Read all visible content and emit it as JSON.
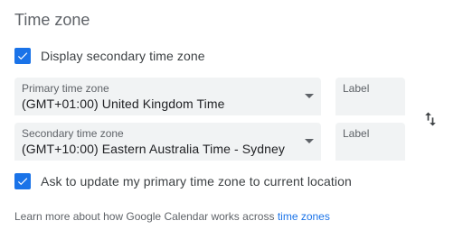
{
  "section": {
    "title": "Time zone"
  },
  "display_secondary": {
    "label": "Display secondary time zone",
    "checked": true
  },
  "primary": {
    "caption": "Primary time zone",
    "value": "(GMT+01:00) United Kingdom Time",
    "label_placeholder": "Label"
  },
  "secondary": {
    "caption": "Secondary time zone",
    "value": "(GMT+10:00) Eastern Australia Time - Sydney",
    "label_placeholder": "Label"
  },
  "ask_update": {
    "label": "Ask to update my primary time zone to current location",
    "checked": true
  },
  "footer": {
    "text": "Learn more about how Google Calendar works across ",
    "link": "time zones"
  },
  "icons": {
    "checkbox": "check-icon",
    "swap": "swap-vert-icon",
    "dropdown": "dropdown-arrow-icon"
  },
  "colors": {
    "accent": "#1a73e8",
    "field_bg": "#f1f3f4",
    "text": "#3c4043",
    "muted": "#5f6368"
  }
}
